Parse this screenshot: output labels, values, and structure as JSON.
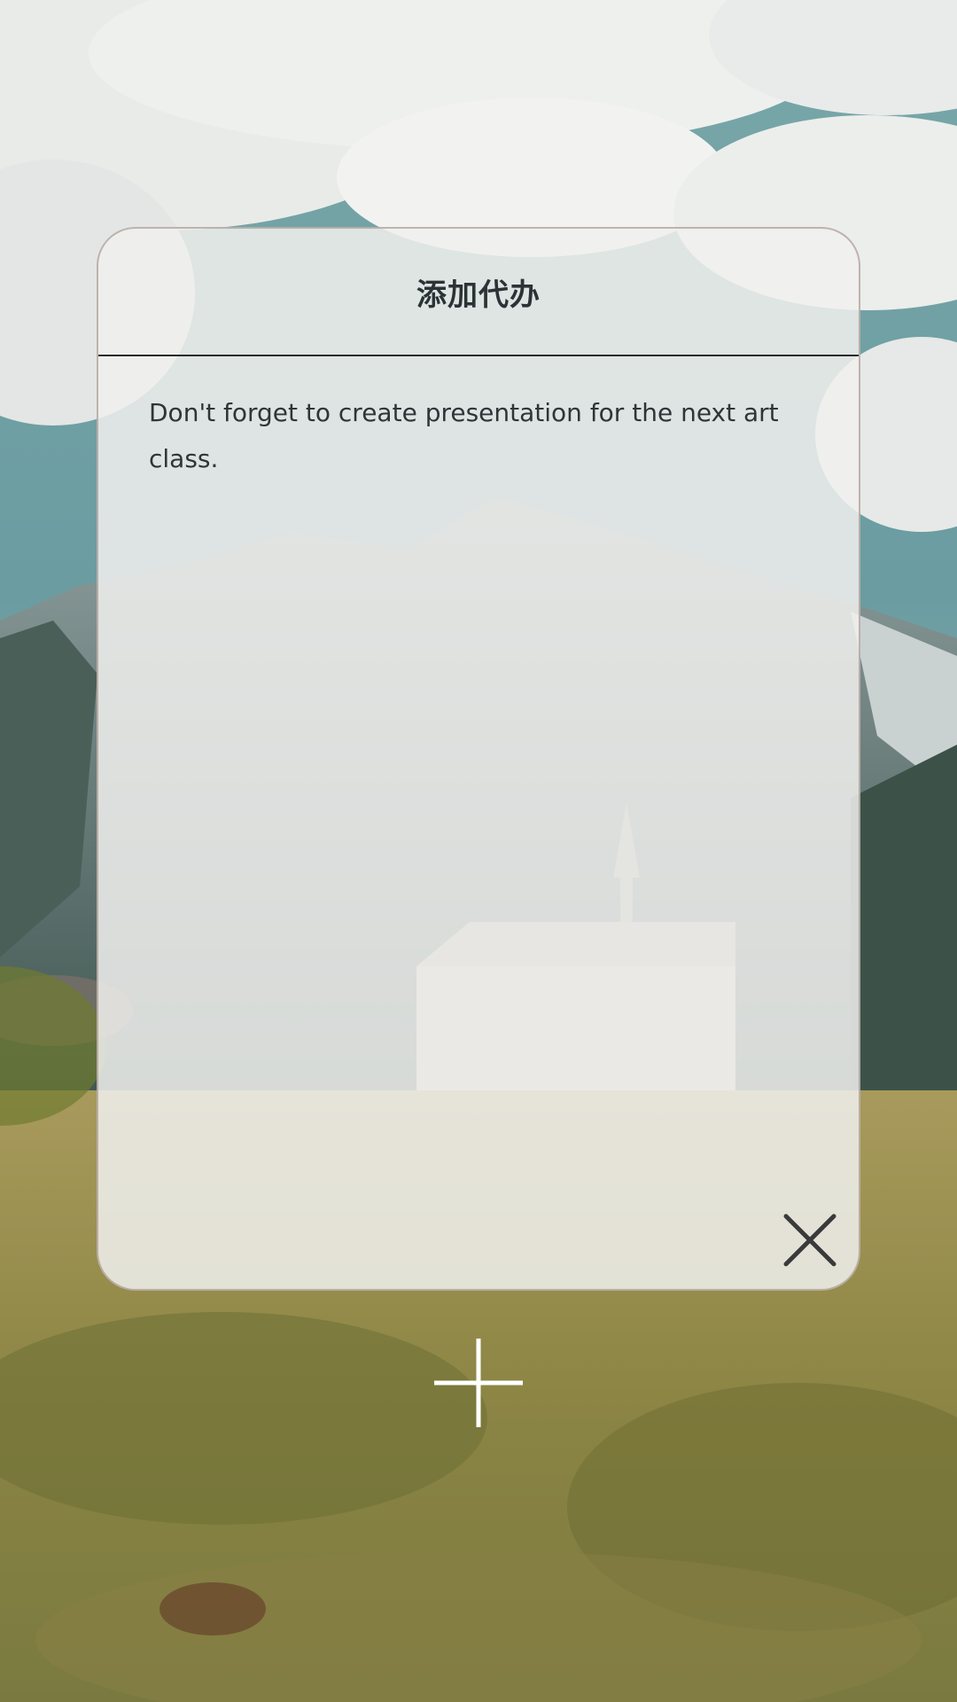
{
  "dialog": {
    "title": "添加代办",
    "todo_text": "Don't forget to create presentation for the next art class."
  },
  "icons": {
    "close": "close-icon",
    "add": "plus-icon"
  },
  "colors": {
    "text": "#2e3538",
    "divider": "#2a2a2a",
    "sky": "#6f9ea0",
    "grass": "#a59556"
  }
}
